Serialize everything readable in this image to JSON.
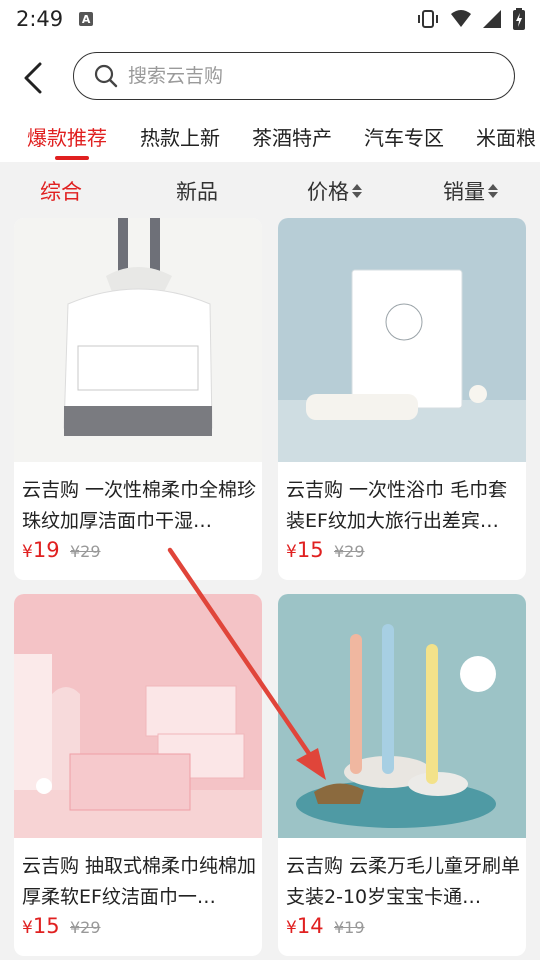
{
  "status_bar": {
    "time": "2:49",
    "a_icon": "A"
  },
  "header": {
    "search_placeholder": "搜索云吉购"
  },
  "category_tabs": [
    "爆款推荐",
    "热款上新",
    "茶酒特产",
    "汽车专区",
    "米面粮"
  ],
  "sort_bar": [
    "综合",
    "新品",
    "价格",
    "销量"
  ],
  "products": [
    {
      "title": "云吉购 一次性棉柔巾全棉珍珠纹加厚洁面巾干湿…",
      "price": "19",
      "old_price": "¥29"
    },
    {
      "title": "云吉购 一次性浴巾 毛巾套装EF纹加大旅行出差宾…",
      "price": "15",
      "old_price": "¥29"
    },
    {
      "title": "云吉购 抽取式棉柔巾纯棉加厚柔软EF纹洁面巾一…",
      "price": "15",
      "old_price": "¥29"
    },
    {
      "title": "云吉购 云柔万毛儿童牙刷单支装2-10岁宝宝卡通…",
      "price": "14",
      "old_price": "¥19"
    }
  ],
  "colors": {
    "accent": "#e02020",
    "annotation_arrow": "#e0453a"
  }
}
